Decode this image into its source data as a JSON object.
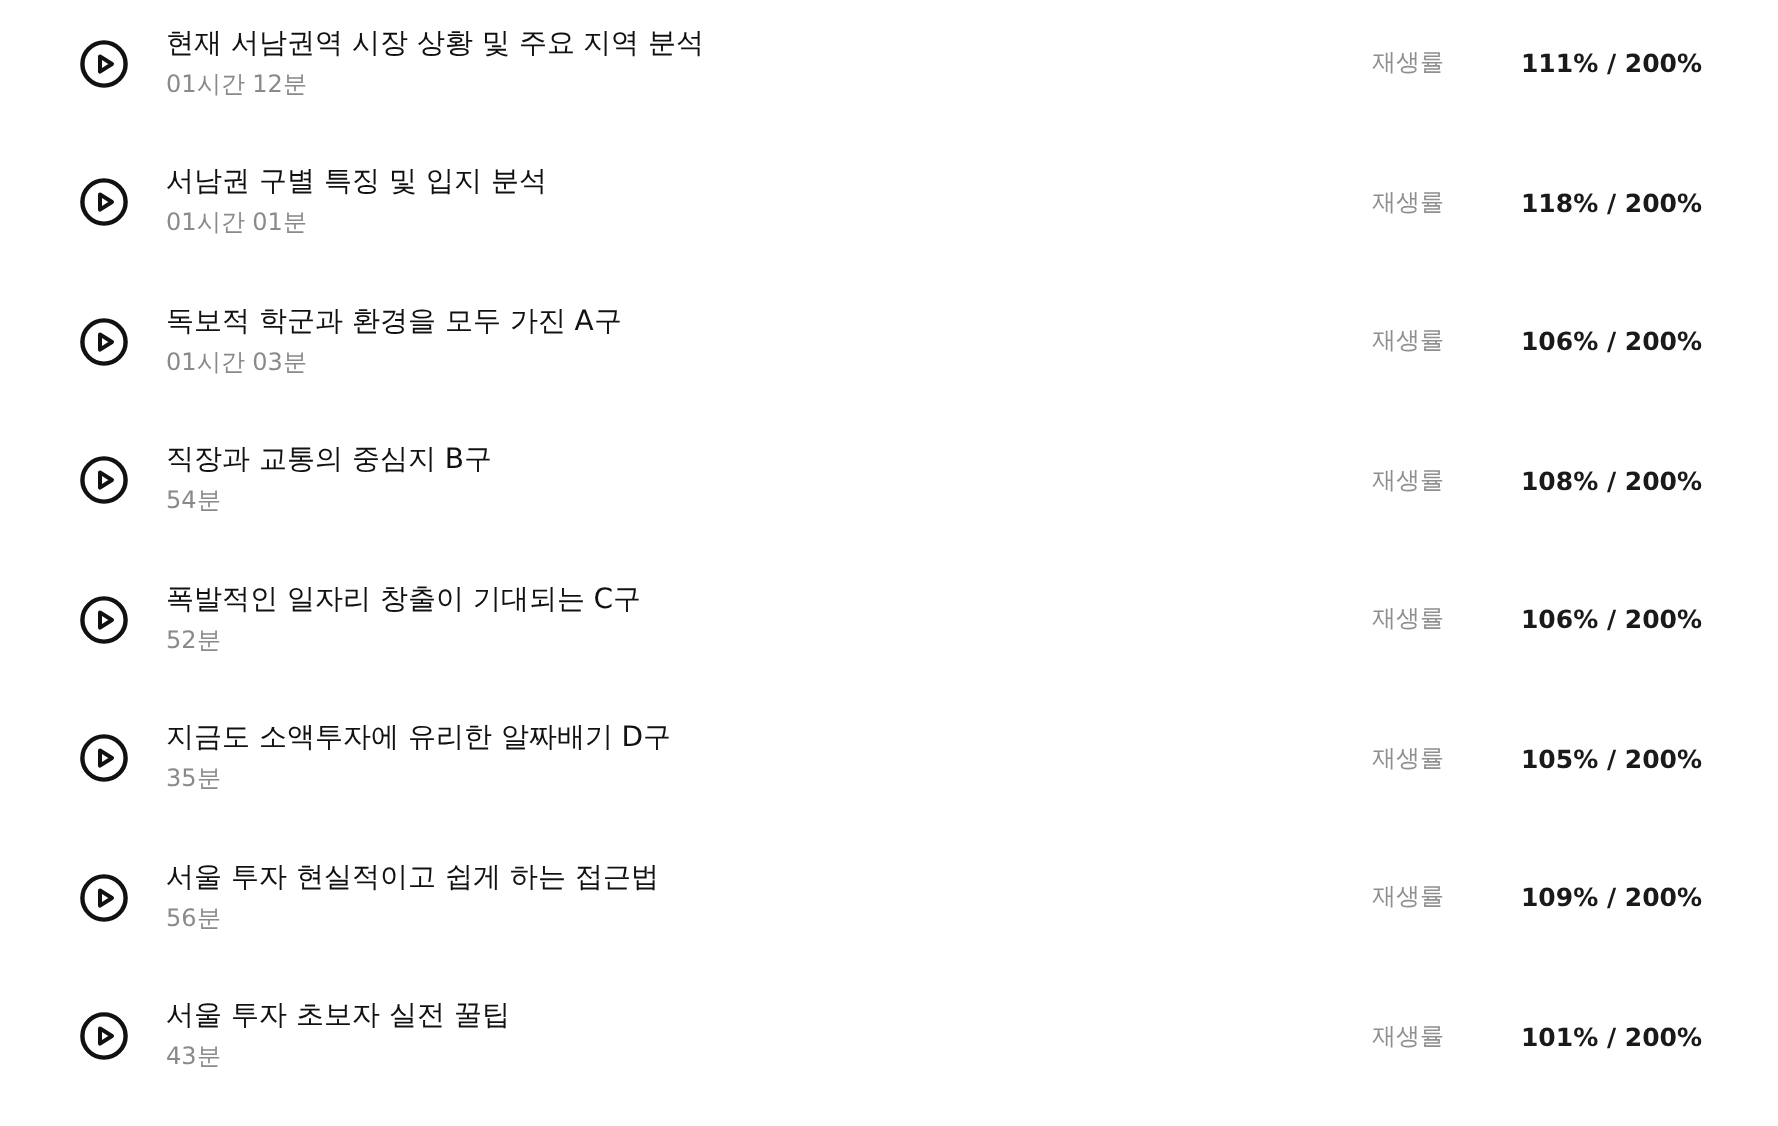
{
  "lessons": [
    {
      "title": "현재 서남권역 시장 상황 및 주요 지역 분석",
      "duration": "01시간 12분",
      "rate_label": "재생률",
      "rate": "111% / 200%"
    },
    {
      "title": "서남권 구별 특징 및 입지 분석",
      "duration": "01시간 01분",
      "rate_label": "재생률",
      "rate": "118% / 200%"
    },
    {
      "title": "독보적 학군과 환경을 모두 가진 A구",
      "duration": "01시간 03분",
      "rate_label": "재생률",
      "rate": "106% / 200%"
    },
    {
      "title": "직장과 교통의 중심지 B구",
      "duration": "54분",
      "rate_label": "재생률",
      "rate": "108% / 200%"
    },
    {
      "title": "폭발적인 일자리 창출이 기대되는 C구",
      "duration": "52분",
      "rate_label": "재생률",
      "rate": "106% / 200%"
    },
    {
      "title": "지금도 소액투자에 유리한 알짜배기 D구",
      "duration": "35분",
      "rate_label": "재생률",
      "rate": "105% / 200%"
    },
    {
      "title": "서울 투자 현실적이고 쉽게 하는 접근법",
      "duration": "56분",
      "rate_label": "재생률",
      "rate": "109% / 200%"
    },
    {
      "title": "서울 투자 초보자 실전 꿀팁",
      "duration": "43분",
      "rate_label": "재생률",
      "rate": "101% / 200%"
    }
  ]
}
